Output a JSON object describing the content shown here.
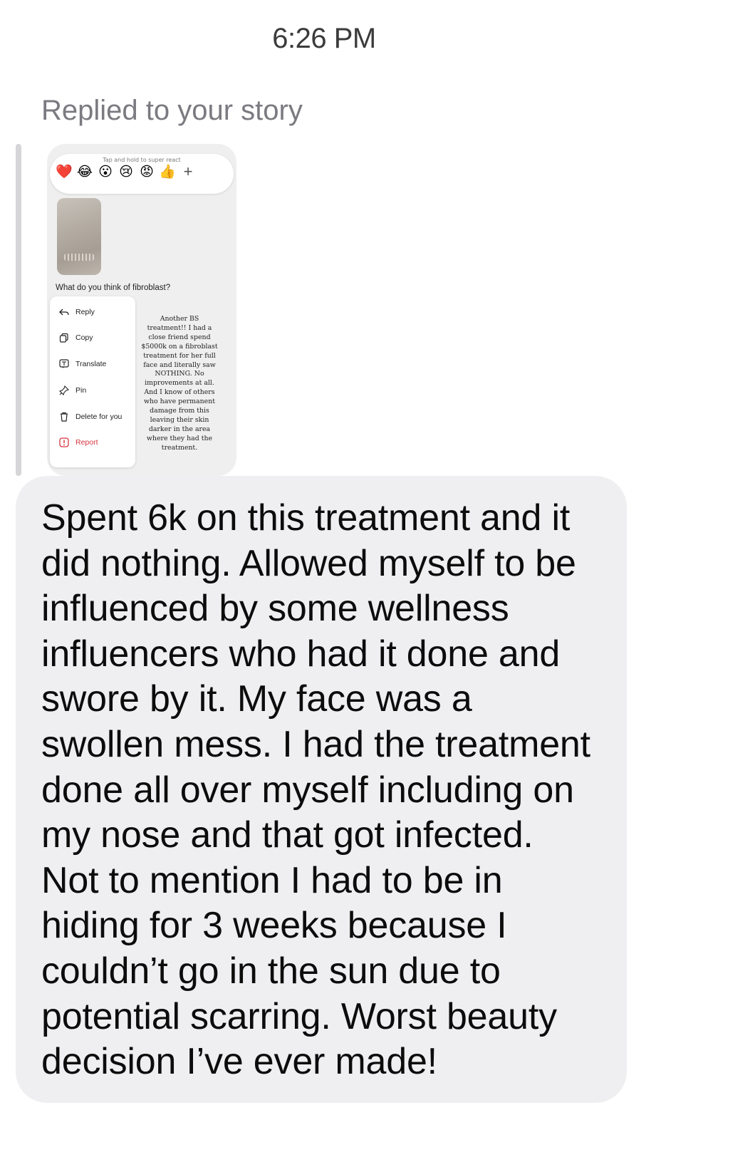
{
  "timestamp": "6:26 PM",
  "replied_label": "Replied to your story",
  "story": {
    "react_hint": "Tap and hold to super react",
    "reactions": [
      "❤️",
      "😂",
      "😮",
      "😢",
      "😡",
      "👍"
    ],
    "add_reaction": "+",
    "question": "What do you think of fibroblast?",
    "menu": {
      "reply": "Reply",
      "copy": "Copy",
      "translate": "Translate",
      "pin": "Pin",
      "delete": "Delete for you",
      "report": "Report"
    },
    "reply_text": "Another BS treatment!! I had a close friend spend $5000k on a fibroblast treatment for her full face and literally saw NOTHING. No improvements at all. And I know of others who have permanent damage from this leaving their skin darker in the area where they had the treatment."
  },
  "message": {
    "text": "Spent 6k on this treatment and it\ndid nothing. Allowed myself to be\ninfluenced by some wellness\ninfluencers who had it done and\nswore by it. My face was a\nswollen mess. I had the treatment\ndone all over myself including on\nmy nose and that got infected.\nNot to mention I had to be in\nhiding for 3 weeks because I\ncouldn’t go in the sun due to\npotential scarring. Worst beauty\ndecision I’ve ever made!"
  },
  "colors": {
    "bubble": "#efeff1",
    "report_red": "#d6353f",
    "secondary_text": "#7a7a80"
  }
}
